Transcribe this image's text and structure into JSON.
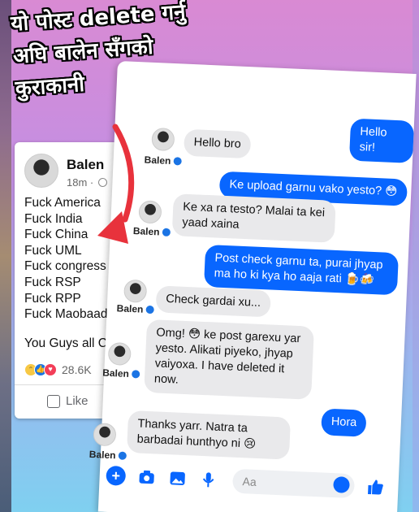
{
  "headline": {
    "line1": "यो पोस्ट delete गर्नु",
    "line2": "अघि बालेन सँगको",
    "line3": "कुराकानी"
  },
  "post": {
    "author": "Balen",
    "time": "18m ·",
    "lines": [
      "Fuck America",
      "Fuck India",
      "Fuck China",
      "Fuck UML",
      "Fuck  congress",
      "Fuck RSP",
      "Fuck RPP",
      "Fuck Maobaadi"
    ],
    "closing": "You Guys all Cor",
    "reaction_count": "28.6K",
    "like_label": "Like"
  },
  "chat": {
    "sender_name": "Balen",
    "messages": [
      {
        "dir": "out",
        "text": "Hello sir!"
      },
      {
        "dir": "in",
        "text": "Hello bro"
      },
      {
        "dir": "out",
        "text": "Ke upload garnu vako yesto? 😳"
      },
      {
        "dir": "in",
        "text": "Ke xa ra testo? Malai ta kei yaad xaina"
      },
      {
        "dir": "out",
        "text": "Post check garnu ta, purai jhyap ma ho ki kya ho aaja rati 🍺🍻"
      },
      {
        "dir": "in",
        "text": "Check gardai xu..."
      },
      {
        "dir": "in",
        "text": "Omg! 😳 ke post garexu yar yesto. Alikati piyeko, jhyap vaiyoxa. I have deleted it now."
      },
      {
        "dir": "out",
        "text": "Hora"
      },
      {
        "dir": "in",
        "text": "Thanks yarr. Natra ta barbadai hunthyo ni 😢"
      }
    ],
    "composer_placeholder": "Aa"
  },
  "icons": {
    "composer": [
      "plus-icon",
      "camera-icon",
      "image-icon",
      "mic-icon",
      "emoji-icon",
      "thumbs-up-icon"
    ]
  },
  "colors": {
    "messenger_blue": "#0866ff",
    "arrow_red": "#e8323c",
    "incoming_bubble": "#e9e9eb"
  }
}
